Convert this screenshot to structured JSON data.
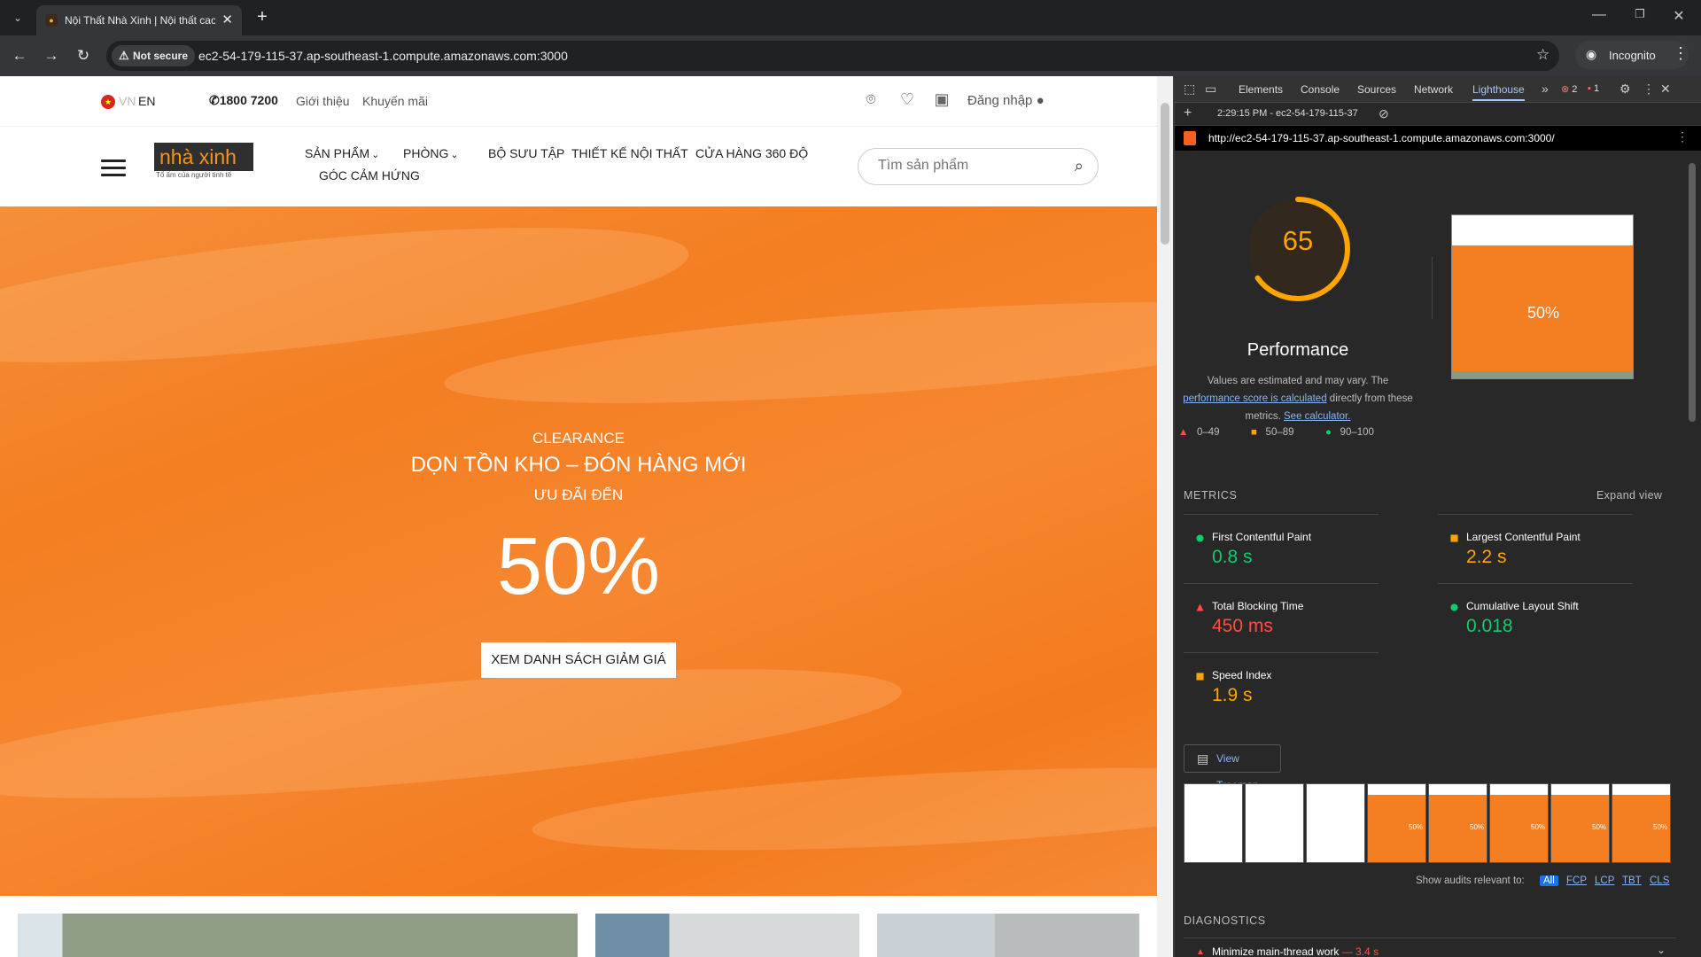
{
  "browser": {
    "tab_title": "Nội Thất Nhà Xinh | Nội thất cao cấp",
    "security_label": "Not secure",
    "url": "ec2-54-179-115-37.ap-southeast-1.compute.amazonaws.com:3000",
    "profile_label": "Incognito"
  },
  "site": {
    "lang_vn": "VN",
    "lang_en": "EN",
    "phone": "1800 7200",
    "top_links": [
      "Giới thiệu",
      "Khuyến mãi"
    ],
    "login_label": "Đăng nhập",
    "logo_text": "nhà xinh",
    "logo_tagline": "Tổ ấm của người tinh tế",
    "nav": [
      "SẢN PHẨM",
      "PHÒNG",
      "BỘ SƯU TẬP",
      "THIẾT KẾ NỘI THẤT",
      "CỬA HÀNG 360 ĐỘ",
      "GÓC CẢM HỨNG"
    ],
    "search_placeholder": "Tìm sản phẩm",
    "hero": {
      "eyebrow": "CLEARANCE",
      "title": "DỌN TỒN KHO – ĐÓN HÀNG MỚI",
      "subtitle": "ƯU ĐÃI ĐẾN",
      "big": "50%",
      "button": "XEM DANH SÁCH GIẢM GIÁ"
    }
  },
  "devtools": {
    "tabs": [
      "Elements",
      "Console",
      "Sources",
      "Network",
      "Lighthouse"
    ],
    "errors": "2",
    "warnings": "1",
    "report_time": "2:29:15 PM - ec2-54-179-115-37",
    "report_url": "http://ec2-54-179-115-37.ap-southeast-1.compute.amazonaws.com:3000/",
    "score": "65",
    "score_fraction": 0.65,
    "category": "Performance",
    "desc_1": "Values are estimated and may vary. The",
    "desc_link_1": "performance score is calculated",
    "desc_2": "directly from these metrics.",
    "desc_link_2": "See calculator.",
    "legend": [
      "0–49",
      "50–89",
      "90–100"
    ],
    "shot_text": "50%",
    "metrics_heading": "METRICS",
    "expand_label": "Expand view",
    "metrics": [
      {
        "label": "First Contentful Paint",
        "value": "0.8 s",
        "status": "good"
      },
      {
        "label": "Largest Contentful Paint",
        "value": "2.2 s",
        "status": "average"
      },
      {
        "label": "Total Blocking Time",
        "value": "450 ms",
        "status": "poor"
      },
      {
        "label": "Cumulative Layout Shift",
        "value": "0.018",
        "status": "good"
      },
      {
        "label": "Speed Index",
        "value": "1.9 s",
        "status": "average"
      }
    ],
    "treemap_label": "View Treemap",
    "show_audits_label": "Show audits relevant to:",
    "audit_filters": [
      "All",
      "FCP",
      "LCP",
      "TBT",
      "CLS"
    ],
    "diagnostics_heading": "DIAGNOSTICS",
    "first_audit": {
      "label": "Minimize main-thread work",
      "value": "— 3.4 s"
    },
    "colors": {
      "good": "#0cce6b",
      "average": "#ffa400",
      "poor": "#ff4e42",
      "brand": "#f47e22"
    }
  }
}
